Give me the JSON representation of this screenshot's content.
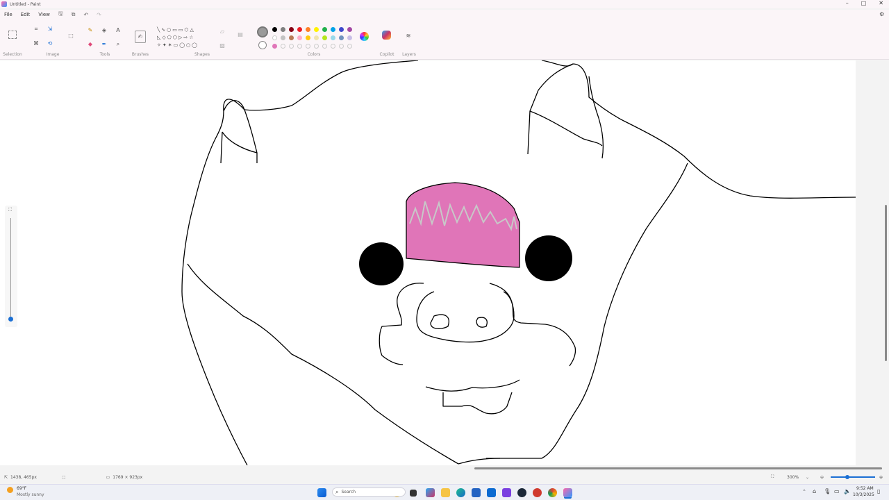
{
  "window": {
    "title": "Untitled - Paint",
    "minimize_glyph": "–",
    "maximize_glyph": "□",
    "close_glyph": "✕"
  },
  "menu": {
    "file": "File",
    "edit": "Edit",
    "view": "View"
  },
  "ribbon": {
    "groups": {
      "selection": "Selection",
      "image": "Image",
      "tools": "Tools",
      "brushes": "Brushes",
      "shapes": "Shapes",
      "colors": "Colors",
      "copilot": "Copilot",
      "layers": "Layers"
    },
    "text_tool_glyph": "A",
    "palette_row1": [
      "#000000",
      "#7f7f7f",
      "#880015",
      "#ed1c24",
      "#ff7f27",
      "#fff200",
      "#22b14c",
      "#00a2e8",
      "#3f48cc",
      "#a349a4"
    ],
    "palette_row2": [
      "#ffffff",
      "#c3c3c3",
      "#b97a57",
      "#ffaec9",
      "#ffc90e",
      "#efe4b0",
      "#b5e61d",
      "#99d9ea",
      "#7092be",
      "#c8bfe7"
    ],
    "custom_color": "#e075b8",
    "primary_color": "#9a9a9a"
  },
  "drawing": {
    "background": "#ffffff",
    "stroke_color": "#000000",
    "hat_color": "#e075b8",
    "hat_scribble_color": "#c8c8c8",
    "eye_color": "#000000"
  },
  "status": {
    "cursor_position": "1438, 465px",
    "canvas_size": "1769 × 923px",
    "zoom_level": "300%"
  },
  "taskbar": {
    "weather_temp": "69°F",
    "weather_text": "Mostly sunny",
    "search_placeholder": "Search",
    "time": "9:52 AM",
    "date": "10/3/2025"
  }
}
